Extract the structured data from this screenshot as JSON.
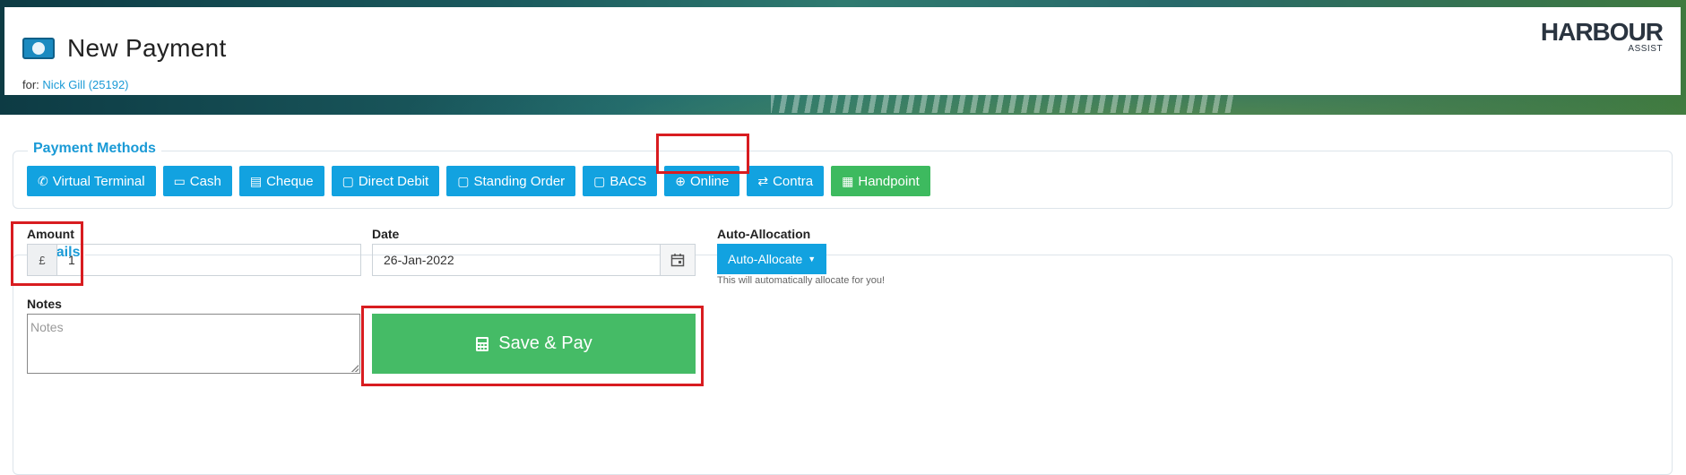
{
  "header": {
    "title": "New Payment",
    "for_prefix": "for:",
    "customer_link": "Nick Gill (25192)",
    "logo_main": "HARBOUR",
    "logo_sub": "ASSIST"
  },
  "payment_methods": {
    "legend": "Payment Methods",
    "buttons": [
      {
        "label": "Virtual Terminal",
        "icon": "phone-icon"
      },
      {
        "label": "Cash",
        "icon": "money-icon"
      },
      {
        "label": "Cheque",
        "icon": "cheque-icon"
      },
      {
        "label": "Direct Debit",
        "icon": "calendar-icon"
      },
      {
        "label": "Standing Order",
        "icon": "calendar-icon"
      },
      {
        "label": "BACS",
        "icon": "calendar-icon"
      },
      {
        "label": "Online",
        "icon": "globe-icon"
      },
      {
        "label": "Contra",
        "icon": "exchange-icon"
      },
      {
        "label": "Handpoint",
        "icon": "calculator-icon",
        "selected": true
      }
    ]
  },
  "details": {
    "legend": "Details",
    "amount_label": "Amount",
    "currency_symbol": "£",
    "amount_value": "1",
    "date_label": "Date",
    "date_value": "26-Jan-2022",
    "auto_allocation_label": "Auto-Allocation",
    "auto_allocate_button": "Auto-Allocate",
    "auto_allocate_help": "This will automatically allocate for you!",
    "notes_label": "Notes",
    "notes_placeholder": "Notes",
    "save_pay_button": "Save & Pay"
  },
  "colors": {
    "primary": "#12a2e0",
    "success": "#45bb66",
    "highlight": "#d81c20",
    "link": "#1a9ad6"
  }
}
